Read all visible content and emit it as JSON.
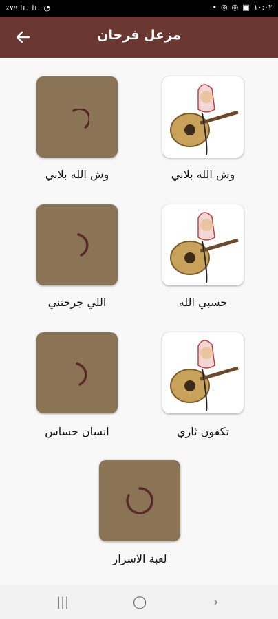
{
  "status_bar": {
    "left_text": "٪۷۹ lı. lı. ◔",
    "time": "١٠:٠٢"
  },
  "app_bar": {
    "title": "مزعل فرحان"
  },
  "songs": [
    {
      "label": "وش الله بلاني",
      "state": "photo"
    },
    {
      "label": "وش الله بلاني",
      "state": "loading"
    },
    {
      "label": "حسبي الله",
      "state": "photo"
    },
    {
      "label": "اللي جرحتني",
      "state": "loading"
    },
    {
      "label": "تكفون ثاري",
      "state": "photo"
    },
    {
      "label": "انسان حساس",
      "state": "loading"
    },
    {
      "label": "لعبة الاسرار",
      "state": "loading"
    }
  ],
  "colors": {
    "app_bar": "#6b3831",
    "loading_tile": "#8b7355",
    "spinner": "#5a2a2a"
  },
  "icons": {
    "back": "arrow-left-icon",
    "loading": "spinner-icon",
    "recents": "recents-icon",
    "home": "home-icon",
    "back_nav": "chevron-right-icon"
  }
}
